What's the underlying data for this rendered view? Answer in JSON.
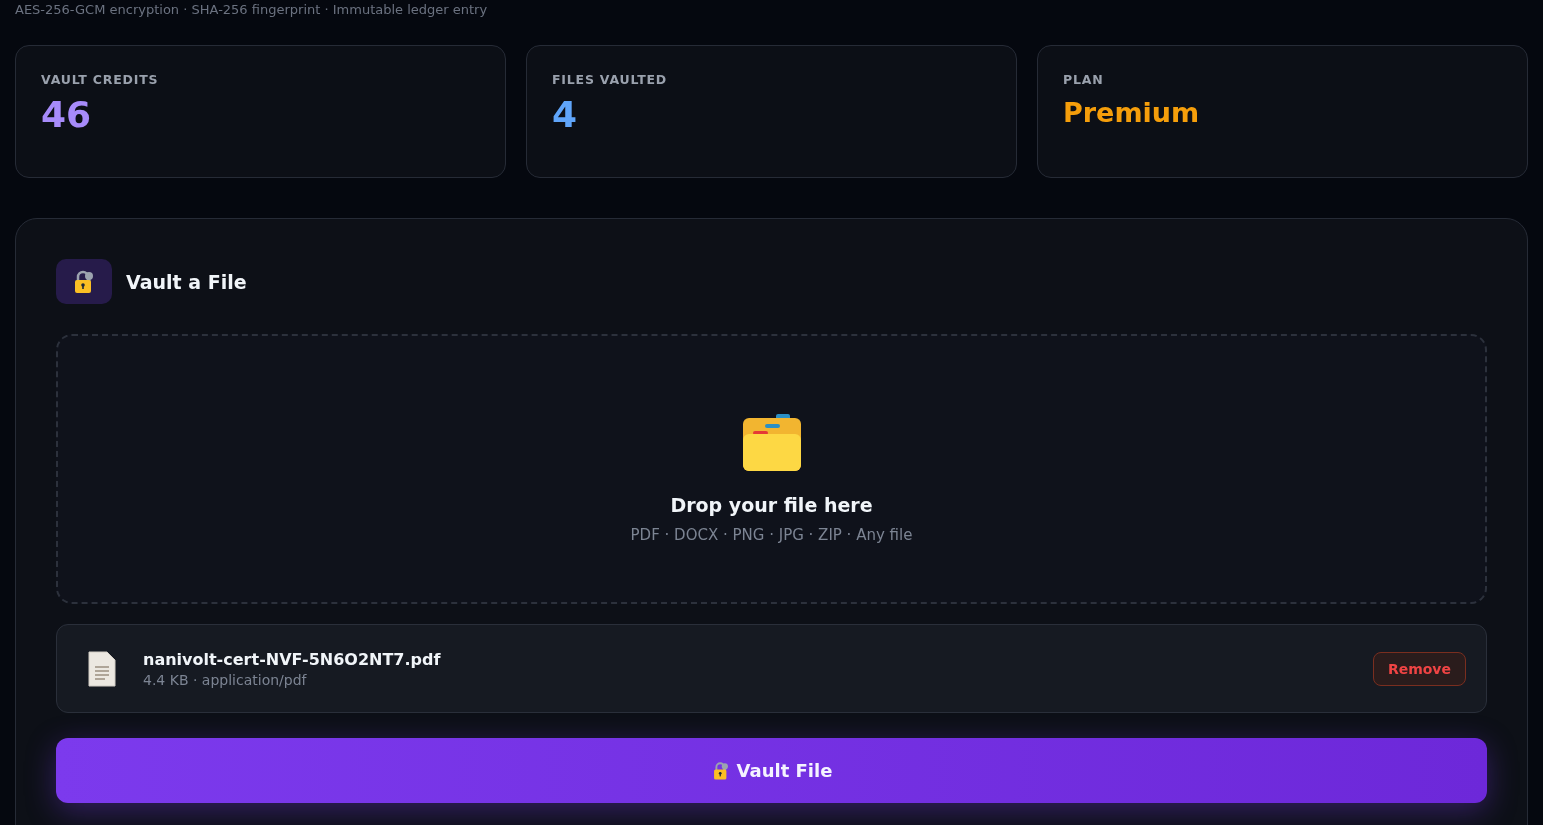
{
  "subtitle": "AES-256-GCM encryption · SHA-256 fingerprint · Immutable ledger entry",
  "stats": [
    {
      "label": "VAULT CREDITS",
      "value": "46",
      "color": "#a78bfa"
    },
    {
      "label": "FILES VAULTED",
      "value": "4",
      "color": "#60a5fa"
    },
    {
      "label": "PLAN",
      "value": "Premium",
      "color": "#f59e0b"
    }
  ],
  "panel": {
    "title": "Vault a File",
    "dropzone": {
      "title": "Drop your file here",
      "hint": "PDF · DOCX · PNG · JPG · ZIP · Any file"
    },
    "file": {
      "name": "nanivolt-cert-NVF-5N6O2NT7.pdf",
      "meta": "4.4 KB · application/pdf",
      "remove": "Remove"
    },
    "submit": "Vault File"
  }
}
